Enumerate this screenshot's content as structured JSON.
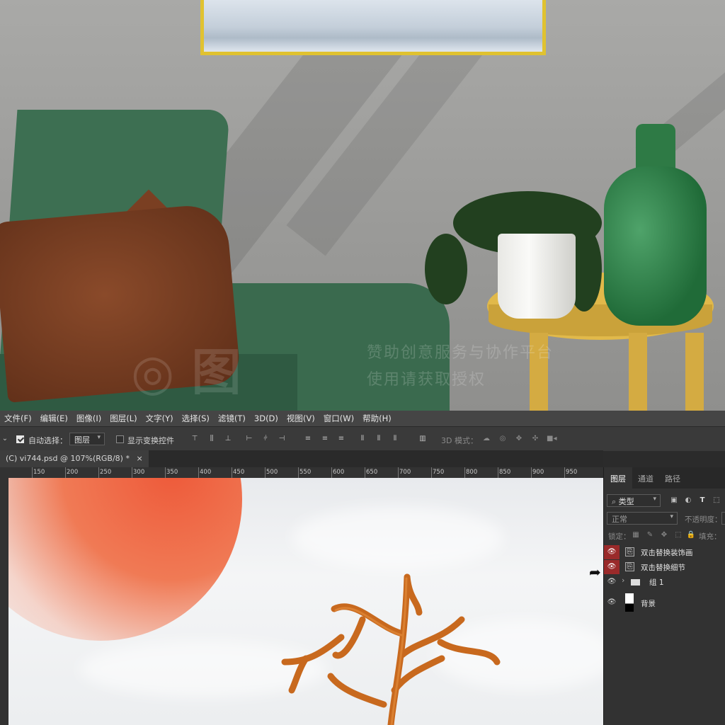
{
  "menubar": {
    "items": [
      "文件(F)",
      "编辑(E)",
      "图像(I)",
      "图层(L)",
      "文字(Y)",
      "选择(S)",
      "滤镜(T)",
      "3D(D)",
      "视图(V)",
      "窗口(W)",
      "帮助(H)"
    ]
  },
  "options": {
    "auto_select_label": "自动选择：",
    "auto_select_checked": true,
    "auto_select_target": "图层",
    "show_transform_label": "显示变换控件",
    "show_transform_checked": false,
    "mode_3d_label": "3D 模式："
  },
  "document": {
    "tab_label": "(C) vi744.psd @ 107%(RGB/8) *",
    "close_glyph": "×"
  },
  "ruler": {
    "top_ticks": [
      "150",
      "200",
      "250",
      "300",
      "350",
      "400",
      "450",
      "500",
      "550",
      "600",
      "650",
      "700",
      "750",
      "800",
      "850",
      "900",
      "950"
    ]
  },
  "watermark": {
    "line1": "赞助创意服务与协作平台",
    "line2": "使用请获取授权"
  },
  "layers_panel": {
    "tabs": [
      "图层",
      "通道",
      "路径"
    ],
    "filter_label": "类型",
    "blend_mode": "正常",
    "opacity_label": "不透明度：",
    "lock_label": "锁定：",
    "fill_label": "填充：",
    "layers": [
      {
        "name": "双击替换装饰画",
        "type": "smart-object",
        "highlight": true
      },
      {
        "name": "双击替换细节",
        "type": "smart-object",
        "highlight": true
      },
      {
        "name": "组 1",
        "type": "group",
        "highlight": false
      },
      {
        "name": "背景",
        "type": "background",
        "highlight": false
      }
    ]
  },
  "colors": {
    "ps_dark": "#2b2b2b",
    "ps_panel": "#323232",
    "eye_highlight": "#9a2a2a",
    "sun": "#ee5a3a",
    "antler": "#c8691e"
  }
}
